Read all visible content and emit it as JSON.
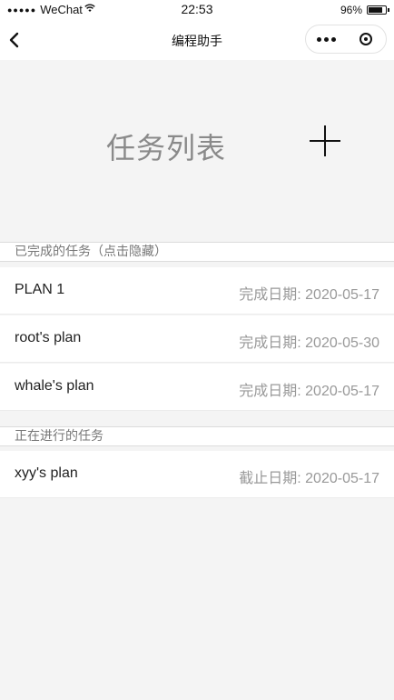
{
  "status_bar": {
    "carrier": "WeChat",
    "time": "22:53",
    "battery": "96%",
    "battery_level": 0.96
  },
  "nav": {
    "title": "编程助手"
  },
  "header": {
    "title": "任务列表",
    "add_icon": "plus-icon"
  },
  "completed": {
    "header": "已完成的任务（点击隐藏）",
    "items": [
      {
        "name": "PLAN 1",
        "date": "完成日期: 2020-05-17"
      },
      {
        "name": "root's plan",
        "date": "完成日期: 2020-05-30"
      },
      {
        "name": "whale's plan",
        "date": "完成日期: 2020-05-17"
      }
    ]
  },
  "in_progress": {
    "header": "正在进行的任务",
    "items": [
      {
        "name": "xyy's plan",
        "date": "截止日期: 2020-05-17"
      }
    ]
  }
}
